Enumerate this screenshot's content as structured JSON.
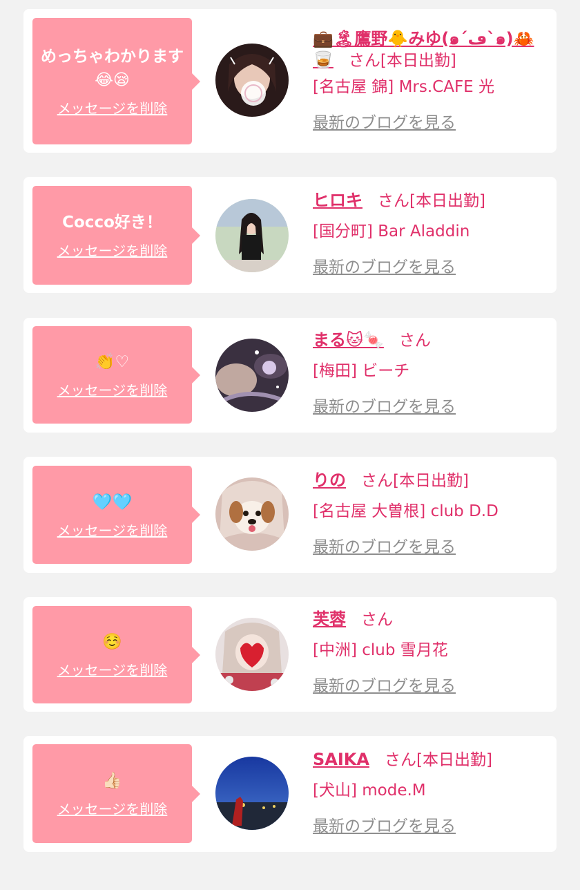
{
  "favorites": [
    {
      "message": "めっちゃわかります😂😪",
      "delete_label": "メッセージを削除",
      "name": "💼🏝鷹野🐥みゆ(๑´ڡ`๑)🦀🥃",
      "san": "さん",
      "status": "[本日出勤]",
      "shop": "[名古屋 錦] Mrs.CAFE 光",
      "blog_label": "最新のブログを見る"
    },
    {
      "message": "Cocco好き！",
      "delete_label": "メッセージを削除",
      "name": "ヒロキ",
      "san": "さん",
      "status": "[本日出勤]",
      "shop": "[国分町] Bar Aladdin",
      "blog_label": "最新のブログを見る"
    },
    {
      "message": "👏♡",
      "delete_label": "メッセージを削除",
      "name": "まる🐱🍬",
      "san": "さん",
      "status": "",
      "shop": "[梅田] ビーチ",
      "blog_label": "最新のブログを見る"
    },
    {
      "message": "🩵🩵",
      "delete_label": "メッセージを削除",
      "name": "りの",
      "san": "さん",
      "status": "[本日出勤]",
      "shop": "[名古屋 大曽根] club D.D",
      "blog_label": "最新のブログを見る"
    },
    {
      "message": "☺️",
      "delete_label": "メッセージを削除",
      "name": "芙蓉",
      "san": "さん",
      "status": "",
      "shop": "[中洲] club 雪月花",
      "blog_label": "最新のブログを見る"
    },
    {
      "message": "👍🏻",
      "delete_label": "メッセージを削除",
      "name": "SAIKA",
      "san": "さん",
      "status": "[本日出勤]",
      "shop": "[犬山] mode.M",
      "blog_label": "最新のブログを見る"
    }
  ],
  "colors": {
    "background": "#f2f2f2",
    "card": "#ffffff",
    "bubble": "#ff9aa7",
    "accent": "#e0306a",
    "muted": "#8e8e8e"
  }
}
